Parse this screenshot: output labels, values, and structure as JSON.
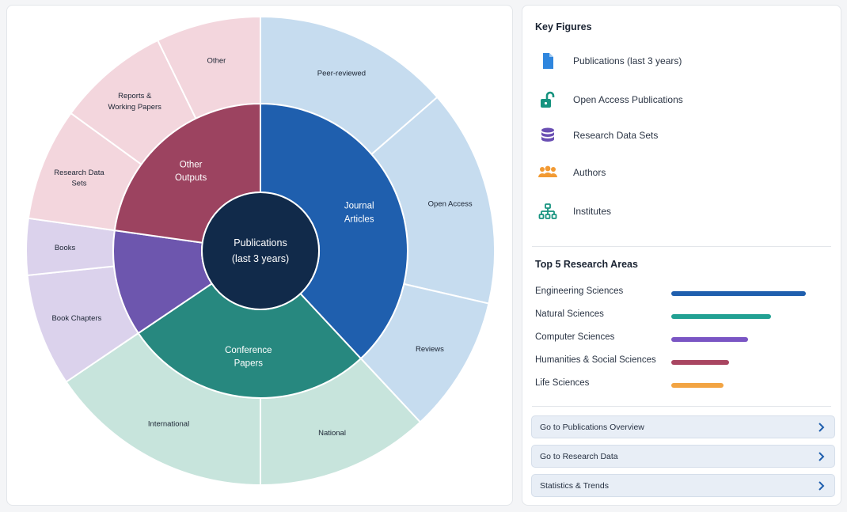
{
  "sunburst": {
    "center_label": [
      "Publications",
      "(last 3 years)"
    ],
    "center_color": "#112a4a",
    "inner": [
      {
        "id": "journal",
        "label": [
          "Journal",
          "Articles"
        ],
        "color": "#1f5fae",
        "start": 0,
        "end": 137
      },
      {
        "id": "conference",
        "label": [
          "Conference",
          "Papers"
        ],
        "color": "#27887f",
        "start": 137,
        "end": 236
      },
      {
        "id": "books-inner",
        "label": [],
        "color": "#6d56ae",
        "start": 236,
        "end": 278
      },
      {
        "id": "other-outputs",
        "label": [
          "Other",
          "Outputs"
        ],
        "color": "#9c4360",
        "start": 278,
        "end": 360
      }
    ],
    "outer": [
      {
        "id": "peer-reviewed",
        "label": [
          "Peer-reviewed"
        ],
        "color": "#c6dcef",
        "start": 0,
        "end": 49
      },
      {
        "id": "open-access",
        "label": [
          "Open Access"
        ],
        "color": "#c6dcef",
        "start": 49,
        "end": 103
      },
      {
        "id": "reviews",
        "label": [
          "Reviews"
        ],
        "color": "#c6dcef",
        "start": 103,
        "end": 137
      },
      {
        "id": "national",
        "label": [
          "National"
        ],
        "color": "#c7e4dc",
        "start": 137,
        "end": 180
      },
      {
        "id": "international",
        "label": [
          "International"
        ],
        "color": "#c7e4dc",
        "start": 180,
        "end": 236
      },
      {
        "id": "book-chapters",
        "label": [
          "Book Chapters"
        ],
        "color": "#dbd2ec",
        "start": 236,
        "end": 264
      },
      {
        "id": "books",
        "label": [
          "Books"
        ],
        "color": "#dbd2ec",
        "start": 264,
        "end": 278
      },
      {
        "id": "research-data-sets",
        "label": [
          "Research Data",
          "Sets"
        ],
        "color": "#f3d6dd",
        "start": 278,
        "end": 306
      },
      {
        "id": "reports",
        "label": [
          "Reports &",
          "Working Papers"
        ],
        "color": "#f3d6dd",
        "start": 306,
        "end": 334
      },
      {
        "id": "other",
        "label": [
          "Other"
        ],
        "color": "#f3d6dd",
        "start": 334,
        "end": 360
      }
    ]
  },
  "key_figures": {
    "title": "Key Figures",
    "items": [
      {
        "label": "Publications (last 3 years)",
        "icon": "document-icon",
        "color": "#2f86de"
      },
      {
        "label": "Open Access Publications",
        "icon": "unlock-icon",
        "color": "#16937f"
      },
      {
        "label": "Research Data Sets",
        "icon": "database-icon",
        "color": "#6a4fb3"
      },
      {
        "label": "Authors",
        "icon": "users-icon",
        "color": "#f29a33"
      },
      {
        "label": "Institutes",
        "icon": "org-chart-icon",
        "color": "#16937f"
      }
    ]
  },
  "research_areas": {
    "title": "Top 5 Research Areas",
    "items": [
      {
        "label": "Engineering Sciences",
        "value": 1.0,
        "color": "#1f5fae"
      },
      {
        "label": "Natural Sciences",
        "value": 0.74,
        "color": "#22a193"
      },
      {
        "label": "Computer Sciences",
        "value": 0.57,
        "color": "#7a55c4"
      },
      {
        "label": "Humanities & Social Sciences",
        "value": 0.43,
        "color": "#a94561"
      },
      {
        "label": "Life Sciences",
        "value": 0.39,
        "color": "#f2a443"
      }
    ]
  },
  "links": [
    {
      "label": "Go to Publications Overview"
    },
    {
      "label": "Go to Research Data"
    },
    {
      "label": "Statistics & Trends"
    }
  ]
}
